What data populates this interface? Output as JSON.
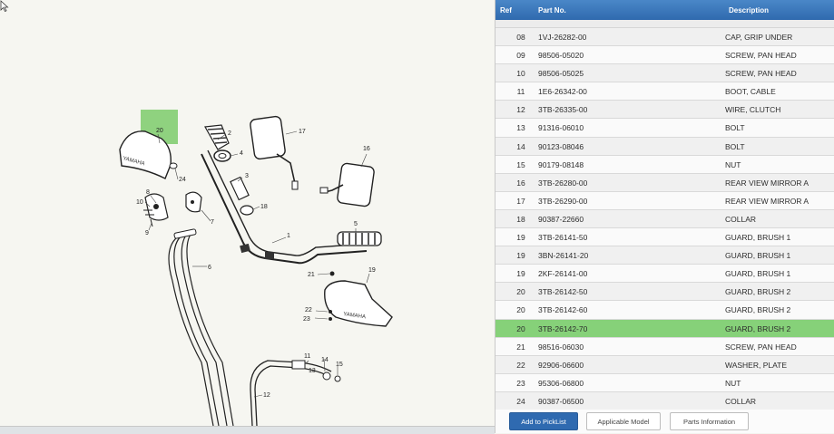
{
  "table": {
    "headers": {
      "ref": "Ref",
      "part_no": "Part No.",
      "description": "Description"
    },
    "rows": [
      {
        "ref": "08",
        "part_no": "1VJ-26282-00",
        "description": "CAP, GRIP UNDER"
      },
      {
        "ref": "09",
        "part_no": "98506-05020",
        "description": "SCREW, PAN HEAD"
      },
      {
        "ref": "10",
        "part_no": "98506-05025",
        "description": "SCREW, PAN HEAD"
      },
      {
        "ref": "11",
        "part_no": "1E6-26342-00",
        "description": "BOOT, CABLE"
      },
      {
        "ref": "12",
        "part_no": "3TB-26335-00",
        "description": "WIRE, CLUTCH"
      },
      {
        "ref": "13",
        "part_no": "91316-06010",
        "description": "BOLT"
      },
      {
        "ref": "14",
        "part_no": "90123-08046",
        "description": "BOLT"
      },
      {
        "ref": "15",
        "part_no": "90179-08148",
        "description": "NUT"
      },
      {
        "ref": "16",
        "part_no": "3TB-26280-00",
        "description": "REAR VIEW MIRROR A"
      },
      {
        "ref": "17",
        "part_no": "3TB-26290-00",
        "description": "REAR VIEW MIRROR A"
      },
      {
        "ref": "18",
        "part_no": "90387-22660",
        "description": "COLLAR"
      },
      {
        "ref": "19",
        "part_no": "3TB-26141-50",
        "description": "GUARD, BRUSH 1"
      },
      {
        "ref": "19",
        "part_no": "3BN-26141-20",
        "description": "GUARD, BRUSH 1"
      },
      {
        "ref": "19",
        "part_no": "2KF-26141-00",
        "description": "GUARD, BRUSH 1"
      },
      {
        "ref": "20",
        "part_no": "3TB-26142-50",
        "description": "GUARD, BRUSH 2"
      },
      {
        "ref": "20",
        "part_no": "3TB-26142-60",
        "description": "GUARD, BRUSH 2"
      },
      {
        "ref": "20",
        "part_no": "3TB-26142-70",
        "description": "GUARD, BRUSH 2",
        "selected": true
      },
      {
        "ref": "21",
        "part_no": "98516-06030",
        "description": "SCREW, PAN HEAD"
      },
      {
        "ref": "22",
        "part_no": "92906-06600",
        "description": "WASHER, PLATE"
      },
      {
        "ref": "23",
        "part_no": "95306-06800",
        "description": "NUT"
      },
      {
        "ref": "24",
        "part_no": "90387-06500",
        "description": "COLLAR"
      }
    ]
  },
  "buttons": {
    "add_to_picklist": "Add to PickList",
    "applicable_model": "Applicable Model",
    "parts_information": "Parts Information"
  },
  "diagram": {
    "callouts": [
      "1",
      "2",
      "3",
      "4",
      "5",
      "6",
      "7",
      "8",
      "9",
      "10",
      "11",
      "12",
      "13",
      "14",
      "15",
      "16",
      "17",
      "18",
      "19",
      "20",
      "21",
      "22",
      "23",
      "24"
    ],
    "highlighted_ref": "20",
    "guard_brand_text": "YAMAHA"
  },
  "colors": {
    "header_blue": "#3a78bd",
    "selected_row_green": "#86d179",
    "callout_highlight": "#8fd27f"
  }
}
